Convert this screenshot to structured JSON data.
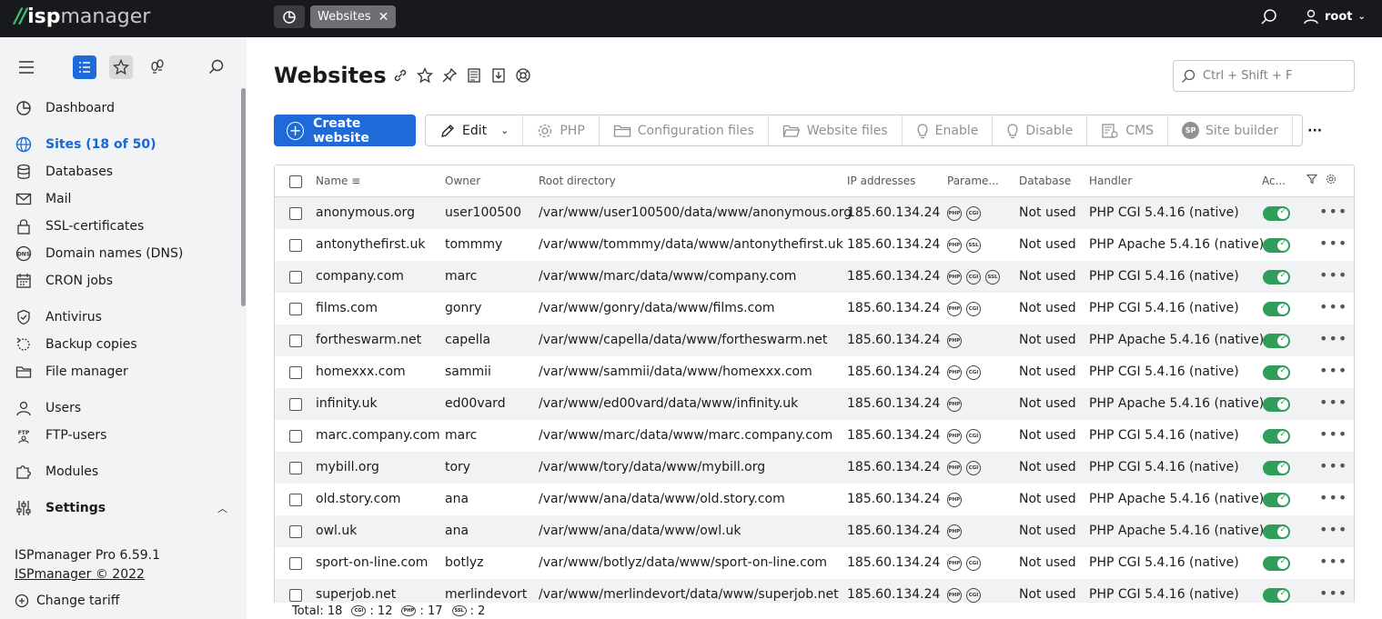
{
  "topbar": {
    "logo_isp": "isp",
    "logo_manager": "manager",
    "active_tab": "Websites",
    "user": "root"
  },
  "sidebar": {
    "items": [
      {
        "label": "Dashboard",
        "icon": "dashboard-icon"
      },
      {
        "label": "Sites (18 of 50)",
        "icon": "globe-icon"
      },
      {
        "label": "Databases",
        "icon": "database-icon"
      },
      {
        "label": "Mail",
        "icon": "mail-icon"
      },
      {
        "label": "SSL-certificates",
        "icon": "lock-icon"
      },
      {
        "label": "Domain names (DNS)",
        "icon": "dns-icon"
      },
      {
        "label": "CRON jobs",
        "icon": "calendar-icon"
      },
      {
        "label": "Antivirus",
        "icon": "shield-icon"
      },
      {
        "label": "Backup copies",
        "icon": "backup-icon"
      },
      {
        "label": "File manager",
        "icon": "folder-icon"
      },
      {
        "label": "Users",
        "icon": "user-icon"
      },
      {
        "label": "FTP-users",
        "icon": "ftp-icon"
      },
      {
        "label": "Modules",
        "icon": "puzzle-icon"
      },
      {
        "label": "Settings",
        "icon": "sliders-icon"
      }
    ],
    "version": "ISPmanager Pro 6.59.1",
    "copyright": "ISPmanager © 2022",
    "change_tariff": "Change tariff"
  },
  "main": {
    "title": "Websites",
    "search_placeholder": "Ctrl + Shift + F",
    "toolbar": {
      "create": "Create website",
      "edit": "Edit",
      "php": "PHP",
      "config_files": "Configuration files",
      "website_files": "Website files",
      "enable": "Enable",
      "disable": "Disable",
      "cms": "CMS",
      "sp_badge": "SP",
      "site_builder": "Site builder",
      "more": "···"
    },
    "columns": {
      "name": "Name",
      "owner": "Owner",
      "root": "Root directory",
      "ip": "IP addresses",
      "params": "Parame...",
      "database": "Database",
      "handler": "Handler",
      "active": "Ac..."
    },
    "param_labels": {
      "php": "PHP",
      "cgi": "CGI",
      "ssl": "SSL"
    },
    "rows": [
      {
        "name": "anonymous.org",
        "owner": "user100500",
        "root": "/var/www/user100500/data/www/anonymous.org",
        "ip": "185.60.134.24",
        "params": [
          "PHP",
          "CGI"
        ],
        "db": "Not used",
        "handler": "PHP CGI 5.4.16 (native)"
      },
      {
        "name": "antonythefirst.uk",
        "owner": "tommmy",
        "root": "/var/www/tommmy/data/www/antonythefirst.uk",
        "ip": "185.60.134.24",
        "params": [
          "PHP",
          "SSL"
        ],
        "db": "Not used",
        "handler": "PHP Apache 5.4.16 (native)"
      },
      {
        "name": "company.com",
        "owner": "marc",
        "root": "/var/www/marc/data/www/company.com",
        "ip": "185.60.134.24",
        "params": [
          "PHP",
          "CGI",
          "SSL"
        ],
        "db": "Not used",
        "handler": "PHP CGI 5.4.16 (native)"
      },
      {
        "name": "films.com",
        "owner": "gonry",
        "root": "/var/www/gonry/data/www/films.com",
        "ip": "185.60.134.24",
        "params": [
          "PHP",
          "CGI"
        ],
        "db": "Not used",
        "handler": "PHP CGI 5.4.16 (native)"
      },
      {
        "name": "fortheswarm.net",
        "owner": "capella",
        "root": "/var/www/capella/data/www/fortheswarm.net",
        "ip": "185.60.134.24",
        "params": [
          "PHP"
        ],
        "db": "Not used",
        "handler": "PHP Apache 5.4.16 (native)"
      },
      {
        "name": "homexxx.com",
        "owner": "sammii",
        "root": "/var/www/sammii/data/www/homexxx.com",
        "ip": "185.60.134.24",
        "params": [
          "PHP",
          "CGI"
        ],
        "db": "Not used",
        "handler": "PHP CGI 5.4.16 (native)"
      },
      {
        "name": "infinity.uk",
        "owner": "ed00vard",
        "root": "/var/www/ed00vard/data/www/infinity.uk",
        "ip": "185.60.134.24",
        "params": [
          "PHP"
        ],
        "db": "Not used",
        "handler": "PHP Apache 5.4.16 (native)"
      },
      {
        "name": "marc.company.com",
        "owner": "marc",
        "root": "/var/www/marc/data/www/marc.company.com",
        "ip": "185.60.134.24",
        "params": [
          "PHP",
          "CGI"
        ],
        "db": "Not used",
        "handler": "PHP CGI 5.4.16 (native)"
      },
      {
        "name": "mybill.org",
        "owner": "tory",
        "root": "/var/www/tory/data/www/mybill.org",
        "ip": "185.60.134.24",
        "params": [
          "PHP",
          "CGI"
        ],
        "db": "Not used",
        "handler": "PHP CGI 5.4.16 (native)"
      },
      {
        "name": "old.story.com",
        "owner": "ana",
        "root": "/var/www/ana/data/www/old.story.com",
        "ip": "185.60.134.24",
        "params": [
          "PHP"
        ],
        "db": "Not used",
        "handler": "PHP Apache 5.4.16 (native)"
      },
      {
        "name": "owl.uk",
        "owner": "ana",
        "root": "/var/www/ana/data/www/owl.uk",
        "ip": "185.60.134.24",
        "params": [
          "PHP"
        ],
        "db": "Not used",
        "handler": "PHP Apache 5.4.16 (native)"
      },
      {
        "name": "sport-on-line.com",
        "owner": "botlyz",
        "root": "/var/www/botlyz/data/www/sport-on-line.com",
        "ip": "185.60.134.24",
        "params": [
          "PHP",
          "CGI"
        ],
        "db": "Not used",
        "handler": "PHP CGI 5.4.16 (native)"
      },
      {
        "name": "superjob.net",
        "owner": "merlindevort",
        "root": "/var/www/merlindevort/data/www/superjob.net",
        "ip": "185.60.134.24",
        "params": [
          "PHP",
          "CGI"
        ],
        "db": "Not used",
        "handler": "PHP CGI 5.4.16 (native)"
      }
    ],
    "footer": {
      "total_label": "Total: 18",
      "cgi_count": ": 12",
      "php_count": ": 17",
      "ssl_count": ": 2"
    }
  },
  "colors": {
    "accent": "#1d6ad8",
    "topbar": "#18191c",
    "toggle_on": "#2f9e5a",
    "logo_green": "#3fbf73"
  }
}
